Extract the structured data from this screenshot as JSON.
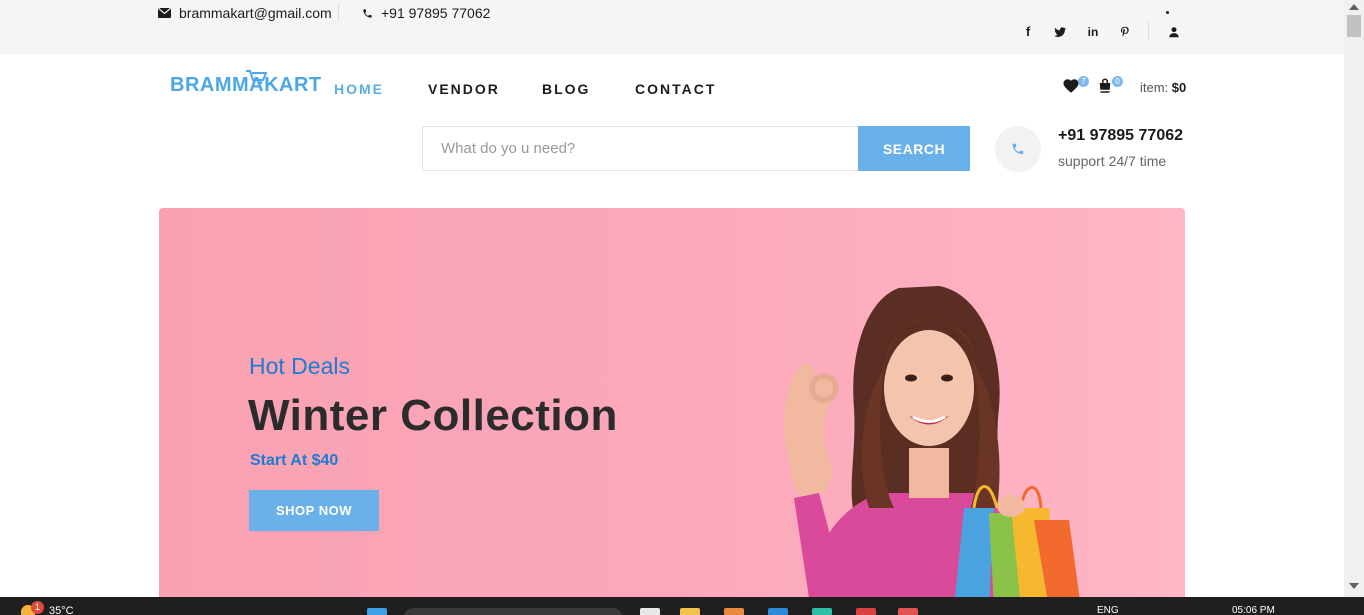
{
  "topbar": {
    "email": "brammakart@gmail.com",
    "phone": "+91 97895 77062",
    "social_icons": [
      "facebook-icon",
      "twitter-icon",
      "linkedin-icon",
      "pinterest-icon",
      "user-icon"
    ]
  },
  "header": {
    "logo_text": "BRAMMAKART",
    "nav": [
      "HOME",
      "VENDOR",
      "BLOG",
      "CONTACT"
    ],
    "active_nav": "HOME",
    "wishlist_count": "7",
    "cart_count": "0",
    "cart_label": "item:",
    "cart_total": "$0"
  },
  "search": {
    "placeholder": "What do yo u need?",
    "button_label": "SEARCH"
  },
  "support": {
    "phone": "+91 97895 77062",
    "text": "support 24/7 time"
  },
  "hero": {
    "kicker": "Hot Deals",
    "title": "Winter Collection",
    "subtitle": "Start At $40",
    "button_label": "SHOP NOW"
  },
  "taskbar": {
    "weather_badge": "1",
    "temperature": "35°C",
    "language": "ENG",
    "time": "05:06 PM"
  },
  "colors": {
    "accent": "#6ab1ea",
    "hero_bg": "#fca9bb",
    "hero_blue_text": "#1f7bd0",
    "topbar_bg": "#f5f5f5"
  }
}
